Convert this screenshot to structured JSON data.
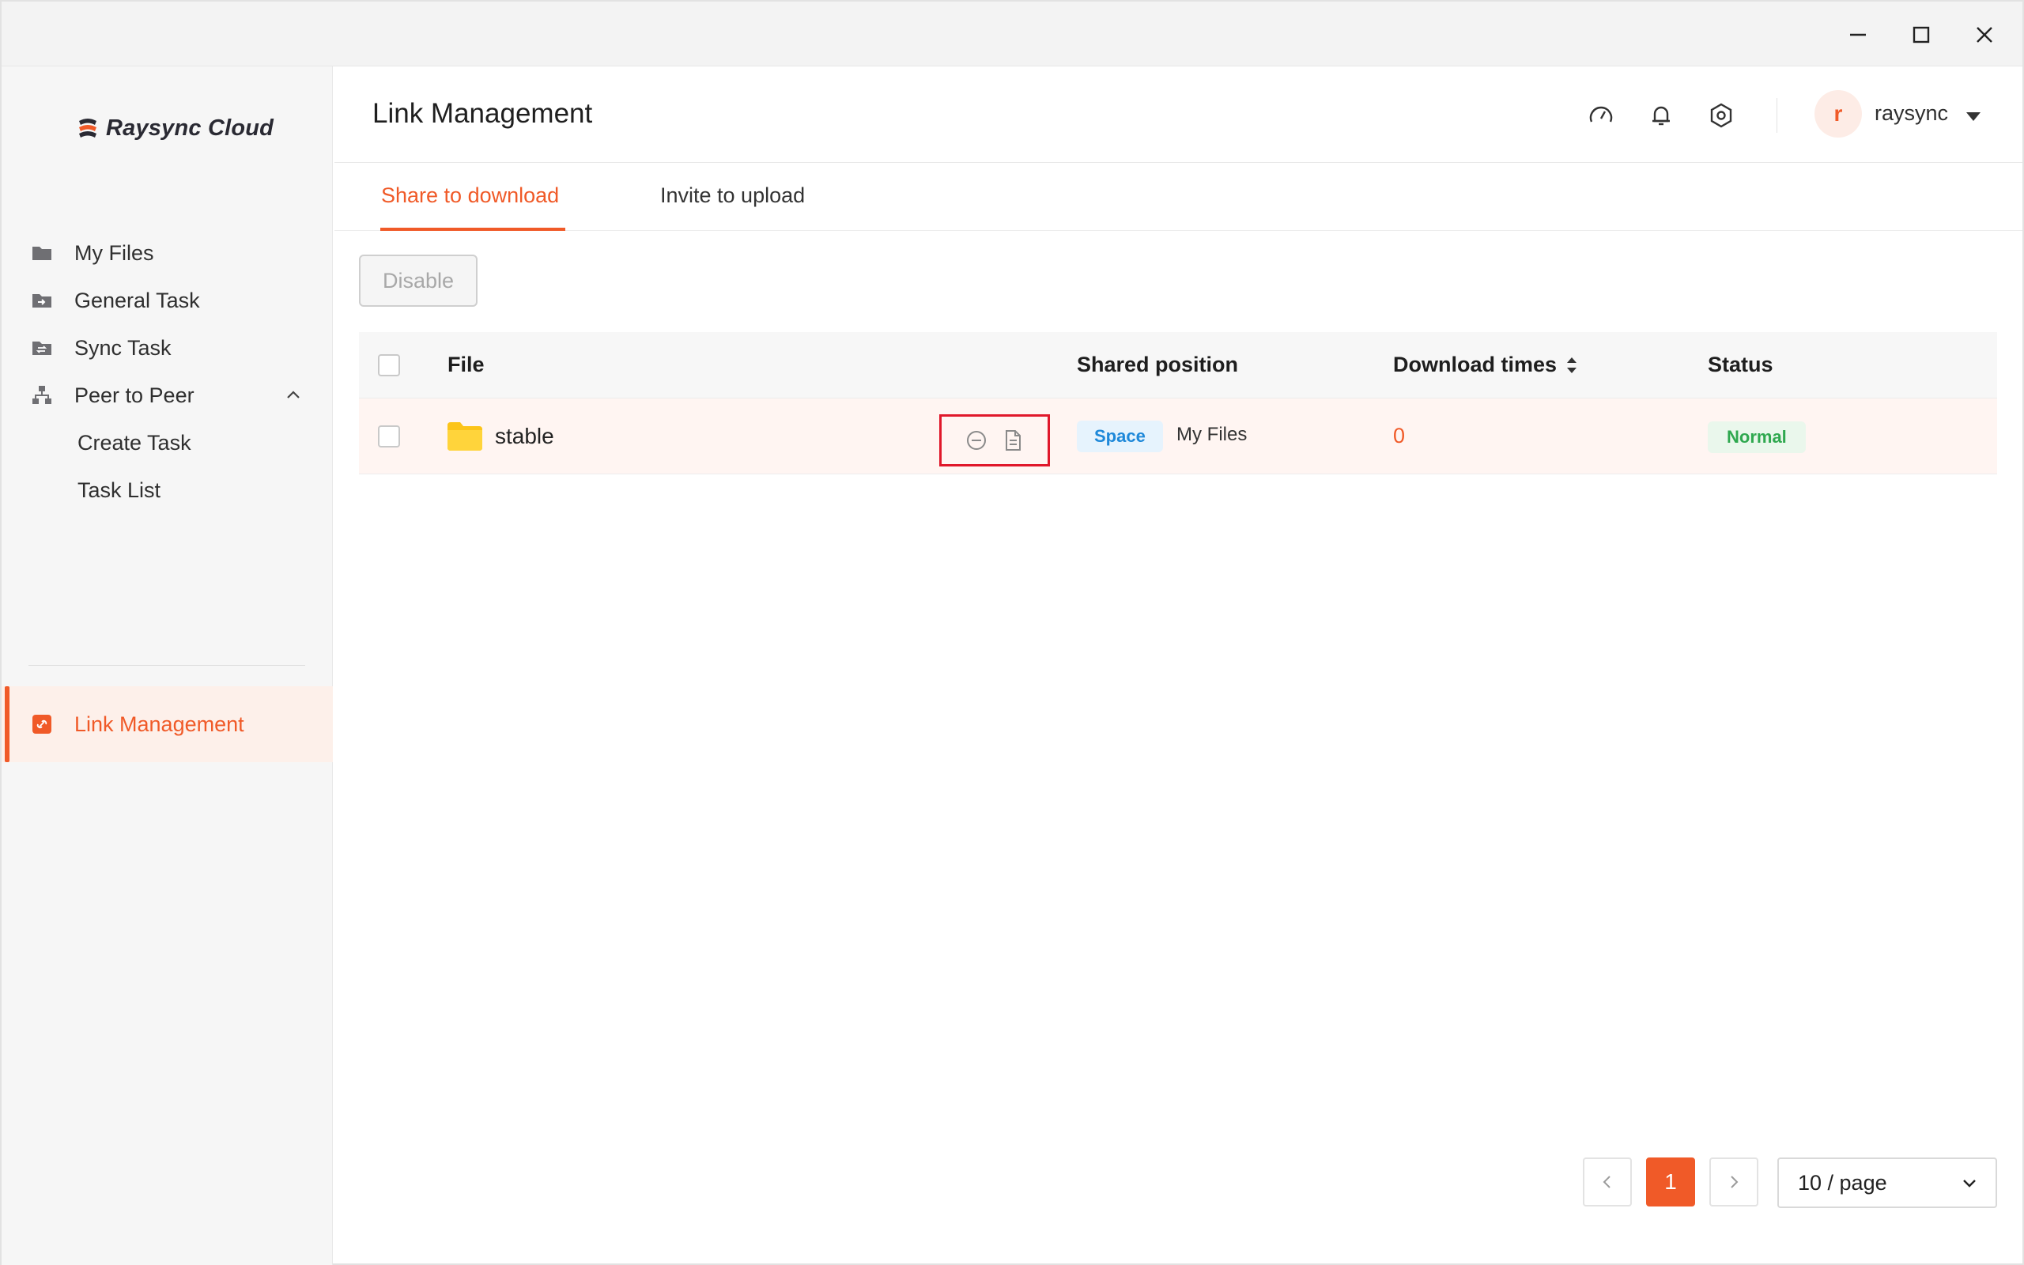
{
  "app": {
    "logo_text": "Raysync Cloud",
    "accent_color": "#f05a28"
  },
  "window_controls": {
    "minimize": "minimize-icon",
    "maximize": "maximize-icon",
    "close": "close-icon"
  },
  "sidebar": {
    "items": [
      {
        "label": "My Files",
        "icon": "folder-icon"
      },
      {
        "label": "General Task",
        "icon": "general-task-icon"
      },
      {
        "label": "Sync Task",
        "icon": "sync-task-icon"
      },
      {
        "label": "Peer to Peer",
        "icon": "network-icon"
      },
      {
        "label": "Create Task"
      },
      {
        "label": "Task List"
      },
      {
        "label": "Link Management",
        "icon": "link-icon",
        "active": true
      }
    ]
  },
  "header": {
    "title": "Link Management",
    "icons": [
      "speed-icon",
      "bell-icon",
      "settings-icon"
    ],
    "avatar_letter": "r",
    "username": "raysync"
  },
  "tabs": [
    {
      "label": "Share to download",
      "active": true
    },
    {
      "label": "Invite to upload",
      "active": false
    }
  ],
  "toolbar": {
    "disable_label": "Disable"
  },
  "table": {
    "columns": [
      "File",
      "Shared position",
      "Download times",
      "Status"
    ],
    "rows": [
      {
        "file": "stable",
        "position_tag": "Space",
        "position": "My Files",
        "download_times": "0",
        "status": "Normal"
      }
    ]
  },
  "pagination": {
    "current_page": "1",
    "page_size": "10 / page"
  }
}
